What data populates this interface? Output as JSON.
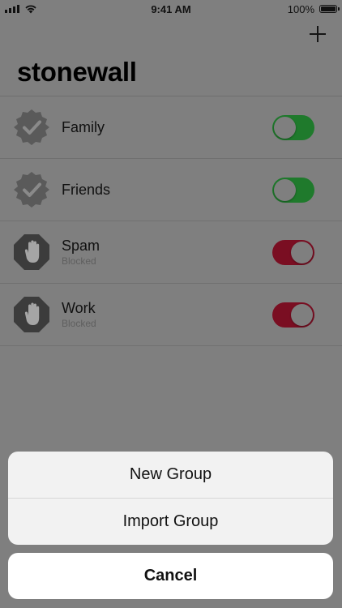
{
  "status_bar": {
    "time": "9:41 AM",
    "battery_percent": "100%",
    "signal_icon": "cellular-signal-icon",
    "wifi_icon": "wifi-icon",
    "battery_icon": "battery-icon"
  },
  "header": {
    "title": "stonewall",
    "add_icon": "plus-icon"
  },
  "groups": [
    {
      "name": "Family",
      "subtitle": "",
      "status": "allowed",
      "icon": "checkmark-badge-icon",
      "toggle": "on"
    },
    {
      "name": "Friends",
      "subtitle": "",
      "status": "allowed",
      "icon": "checkmark-badge-icon",
      "toggle": "on"
    },
    {
      "name": "Spam",
      "subtitle": "Blocked",
      "status": "blocked",
      "icon": "stop-hand-icon",
      "toggle": "blocked"
    },
    {
      "name": "Work",
      "subtitle": "Blocked",
      "status": "blocked",
      "icon": "stop-hand-icon",
      "toggle": "blocked"
    }
  ],
  "action_sheet": {
    "options": [
      "New Group",
      "Import Group"
    ],
    "cancel_label": "Cancel"
  },
  "colors": {
    "dim_background": "#7f7f7f",
    "toggle_on": "#1f7a2c",
    "toggle_blocked": "#7a0e22",
    "sheet_background": "#f2f2f2"
  }
}
